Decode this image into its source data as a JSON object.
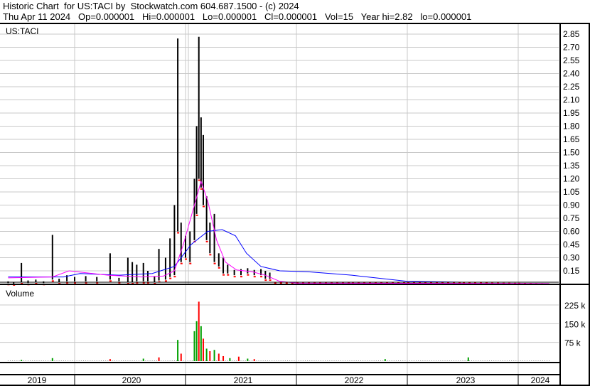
{
  "header": {
    "title": "Historic Chart  for US:TACI by  Stockwatch.com 604.687.1500 - (c) 2024",
    "quote_line": "Thu Apr 11 2024   Op=0.000001   Hi=0.000001   Lo=0.000001   Cl=0.000001   Vol=15   Year hi=2.82   lo=0.000001"
  },
  "colors": {
    "price": "#000000",
    "down": "#ff0000",
    "ma_short": "#ff00ff",
    "ma_long": "#0000ff",
    "vol_up": "#00a000",
    "vol_down": "#ff0000",
    "grid": "#c8c8c8"
  },
  "chart_data": [
    {
      "type": "line",
      "title": "US:TACI",
      "y_ticks": [
        "2.85",
        "2.70",
        "2.55",
        "2.40",
        "2.25",
        "2.10",
        "1.95",
        "1.80",
        "1.65",
        "1.50",
        "1.35",
        "1.20",
        "1.05",
        "0.90",
        "0.75",
        "0.60",
        "0.45",
        "0.30",
        "0.15"
      ],
      "ylim": [
        0,
        2.9
      ],
      "x_ticks": [
        "2019",
        "2020",
        "2021",
        "2022",
        "2023",
        "2024"
      ],
      "bars_year_hi_lo": [
        [
          2019.4,
          0.03,
          0.01
        ],
        [
          2019.45,
          0.02,
          0.005
        ],
        [
          2019.52,
          0.24,
          0.02
        ],
        [
          2019.58,
          0.04,
          0.01
        ],
        [
          2019.65,
          0.05,
          0.02
        ],
        [
          2019.72,
          0.03,
          0.01
        ],
        [
          2019.8,
          0.56,
          0.05
        ],
        [
          2019.86,
          0.06,
          0.02
        ],
        [
          2019.93,
          0.1,
          0.03
        ],
        [
          2020.0,
          0.08,
          0.03
        ],
        [
          2020.1,
          0.09,
          0.03
        ],
        [
          2020.2,
          0.08,
          0.03
        ],
        [
          2020.32,
          0.35,
          0.05
        ],
        [
          2020.4,
          0.07,
          0.03
        ],
        [
          2020.48,
          0.3,
          0.02
        ],
        [
          2020.52,
          0.25,
          0.02
        ],
        [
          2020.56,
          0.22,
          0.03
        ],
        [
          2020.62,
          0.24,
          0.03
        ],
        [
          2020.66,
          0.15,
          0.03
        ],
        [
          2020.72,
          0.09,
          0.02
        ],
        [
          2020.76,
          0.4,
          0.04
        ],
        [
          2020.82,
          0.3,
          0.05
        ],
        [
          2020.86,
          0.52,
          0.08
        ],
        [
          2020.9,
          0.9,
          0.1
        ],
        [
          2020.93,
          2.8,
          0.6
        ],
        [
          2020.96,
          0.7,
          0.25
        ],
        [
          2021.0,
          0.55,
          0.3
        ],
        [
          2021.04,
          0.6,
          0.25
        ],
        [
          2021.08,
          1.2,
          0.5
        ],
        [
          2021.1,
          1.8,
          0.8
        ],
        [
          2021.12,
          2.82,
          1.2
        ],
        [
          2021.14,
          1.9,
          1.1
        ],
        [
          2021.16,
          1.7,
          0.9
        ],
        [
          2021.19,
          1.0,
          0.5
        ],
        [
          2021.22,
          0.7,
          0.35
        ],
        [
          2021.26,
          0.8,
          0.25
        ],
        [
          2021.3,
          0.35,
          0.2
        ],
        [
          2021.34,
          0.3,
          0.12
        ],
        [
          2021.38,
          0.22,
          0.12
        ],
        [
          2021.44,
          0.16,
          0.1
        ],
        [
          2021.5,
          0.17,
          0.1
        ],
        [
          2021.56,
          0.18,
          0.12
        ],
        [
          2021.62,
          0.16,
          0.1
        ],
        [
          2021.68,
          0.17,
          0.1
        ],
        [
          2021.72,
          0.15,
          0.06
        ],
        [
          2021.76,
          0.13,
          0.06
        ]
      ],
      "tail_dots_year_price": [
        [
          2021.8,
          0.01
        ],
        [
          2022.0,
          0.01
        ],
        [
          2022.5,
          0.01
        ],
        [
          2023.0,
          0.01
        ],
        [
          2023.5,
          0.01
        ],
        [
          2024.0,
          0.005
        ],
        [
          2024.28,
          1e-06
        ]
      ],
      "ma_short_year_value": [
        [
          2019.4,
          0.07
        ],
        [
          2019.8,
          0.08
        ],
        [
          2019.95,
          0.15
        ],
        [
          2020.3,
          0.1
        ],
        [
          2020.6,
          0.08
        ],
        [
          2020.8,
          0.09
        ],
        [
          2020.9,
          0.15
        ],
        [
          2020.98,
          0.45
        ],
        [
          2021.08,
          0.9
        ],
        [
          2021.14,
          1.17
        ],
        [
          2021.2,
          0.95
        ],
        [
          2021.28,
          0.5
        ],
        [
          2021.36,
          0.25
        ],
        [
          2021.46,
          0.16
        ],
        [
          2021.6,
          0.14
        ],
        [
          2021.72,
          0.1
        ],
        [
          2021.85,
          0.03
        ],
        [
          2022.0,
          0.01
        ],
        [
          2024.28,
          0.005
        ]
      ],
      "ma_long_year_value": [
        [
          2019.4,
          0.08
        ],
        [
          2019.9,
          0.08
        ],
        [
          2020.05,
          0.12
        ],
        [
          2020.4,
          0.1
        ],
        [
          2020.7,
          0.12
        ],
        [
          2020.9,
          0.2
        ],
        [
          2021.05,
          0.45
        ],
        [
          2021.2,
          0.6
        ],
        [
          2021.33,
          0.62
        ],
        [
          2021.45,
          0.55
        ],
        [
          2021.55,
          0.35
        ],
        [
          2021.68,
          0.2
        ],
        [
          2021.85,
          0.15
        ],
        [
          2022.1,
          0.14
        ],
        [
          2022.5,
          0.1
        ],
        [
          2023.0,
          0.03
        ],
        [
          2023.5,
          0.02
        ],
        [
          2024.28,
          0.02
        ]
      ]
    },
    {
      "type": "bar",
      "title": "Volume",
      "y_ticks": [
        "225 k",
        "150 k",
        "75 k"
      ],
      "ylim": [
        0,
        240000
      ],
      "volume_year_value_up": [
        [
          2019.52,
          5000,
          1
        ],
        [
          2019.8,
          12000,
          1
        ],
        [
          2020.32,
          8000,
          0
        ],
        [
          2020.62,
          10000,
          1
        ],
        [
          2020.76,
          15000,
          0
        ],
        [
          2020.93,
          85000,
          1
        ],
        [
          2020.96,
          30000,
          0
        ],
        [
          2021.08,
          120000,
          1
        ],
        [
          2021.1,
          160000,
          1
        ],
        [
          2021.12,
          238000,
          0
        ],
        [
          2021.14,
          140000,
          1
        ],
        [
          2021.16,
          90000,
          0
        ],
        [
          2021.19,
          50000,
          1
        ],
        [
          2021.22,
          40000,
          0
        ],
        [
          2021.26,
          45000,
          1
        ],
        [
          2021.3,
          30000,
          0
        ],
        [
          2021.34,
          20000,
          0
        ],
        [
          2021.4,
          12000,
          1
        ],
        [
          2021.48,
          18000,
          0
        ],
        [
          2021.56,
          10000,
          1
        ],
        [
          2021.62,
          8000,
          0
        ],
        [
          2022.8,
          8000,
          1
        ],
        [
          2023.55,
          15000,
          1
        ]
      ]
    }
  ]
}
